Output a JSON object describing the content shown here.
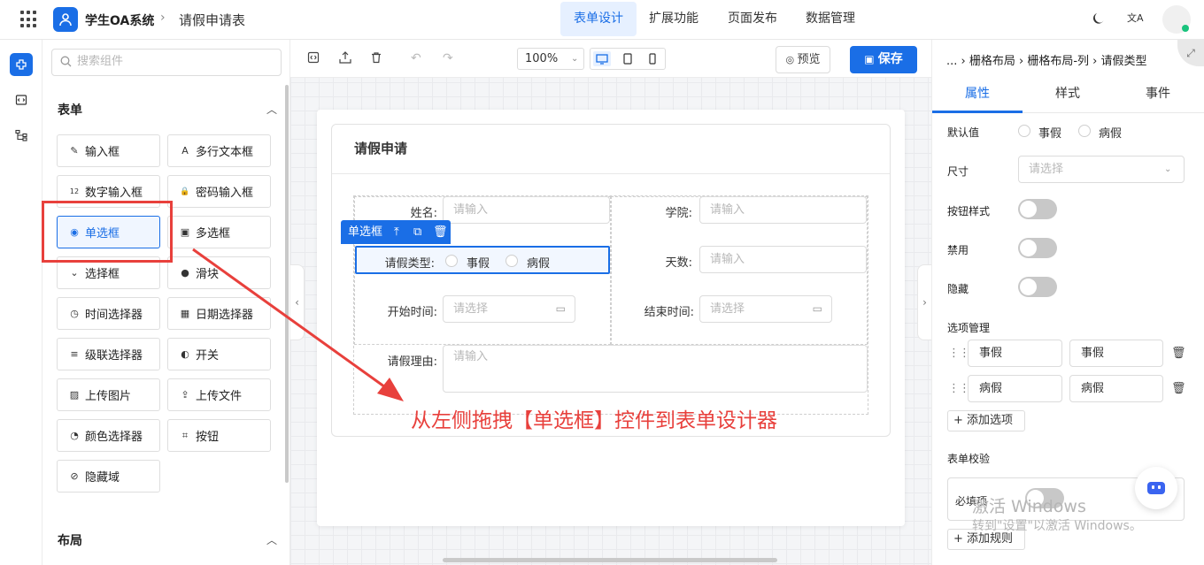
{
  "header": {
    "app_title": "学生OA系统",
    "separator": "›",
    "page_name": "请假申请表",
    "nav": [
      {
        "label": "表单设计"
      },
      {
        "label": "扩展功能"
      },
      {
        "label": "页面发布"
      },
      {
        "label": "数据管理"
      }
    ],
    "lang_glyph": "文A"
  },
  "components": {
    "search_placeholder": "搜索组件",
    "form_section": "表单",
    "items": [
      {
        "label": "输入框",
        "icon": "✎"
      },
      {
        "label": "多行文本框",
        "icon": "A"
      },
      {
        "label": "数字输入框",
        "icon": "12"
      },
      {
        "label": "密码输入框",
        "icon": "🔒"
      },
      {
        "label": "单选框",
        "icon": "◉"
      },
      {
        "label": "多选框",
        "icon": "▣"
      },
      {
        "label": "选择框",
        "icon": "⌄"
      },
      {
        "label": "滑块",
        "icon": "●"
      },
      {
        "label": "时间选择器",
        "icon": "◷"
      },
      {
        "label": "日期选择器",
        "icon": "▦"
      },
      {
        "label": "级联选择器",
        "icon": "≡"
      },
      {
        "label": "开关",
        "icon": "◐"
      },
      {
        "label": "上传图片",
        "icon": "▨"
      },
      {
        "label": "上传文件",
        "icon": "⇪"
      },
      {
        "label": "颜色选择器",
        "icon": "◔"
      },
      {
        "label": "按钮",
        "icon": "⌗"
      },
      {
        "label": "隐藏域",
        "icon": "⊘"
      }
    ],
    "layout_section": "布局"
  },
  "toolbar": {
    "zoom": "100%",
    "preview_label": "预览",
    "save_label": "保存"
  },
  "form": {
    "title": "请假申请",
    "fields": {
      "name_label": "姓名:",
      "name_placeholder": "请输入",
      "college_label": "学院:",
      "college_placeholder": "请输入",
      "leave_type_label": "请假类型:",
      "leave_opt1": "事假",
      "leave_opt2": "病假",
      "days_label": "天数:",
      "days_placeholder": "请输入",
      "start_label": "开始时间:",
      "start_placeholder": "请选择",
      "end_label": "结束时间:",
      "end_placeholder": "请选择",
      "reason_label": "请假理由:",
      "reason_placeholder": "请输入"
    },
    "selected_tag": "单选框"
  },
  "annotation": {
    "text": "从左侧拖拽【单选框】控件到表单设计器",
    "color": "#e8403c"
  },
  "props": {
    "breadcrumb": "... › 栅格布局 › 栅格布局-列 › 请假类型",
    "tabs": [
      {
        "label": "属性"
      },
      {
        "label": "样式"
      },
      {
        "label": "事件"
      }
    ],
    "default_label": "默认值",
    "default_opt1": "事假",
    "default_opt2": "病假",
    "size_label": "尺寸",
    "size_placeholder": "请选择",
    "button_style_label": "按钮样式",
    "disabled_label": "禁用",
    "hidden_label": "隐藏",
    "options_label": "选项管理",
    "options": [
      {
        "label": "事假",
        "value": "事假"
      },
      {
        "label": "病假",
        "value": "病假"
      }
    ],
    "add_option": "+ 添加选项",
    "validation_label": "表单校验",
    "required_label": "必填项",
    "add_rule": "+ 添加规则"
  },
  "watermark": {
    "line1": "激活 Windows",
    "line2": "转到\"设置\"以激活 Windows。"
  },
  "colors": {
    "accent": "#1a6ee6",
    "status_online": "#19c37d"
  }
}
